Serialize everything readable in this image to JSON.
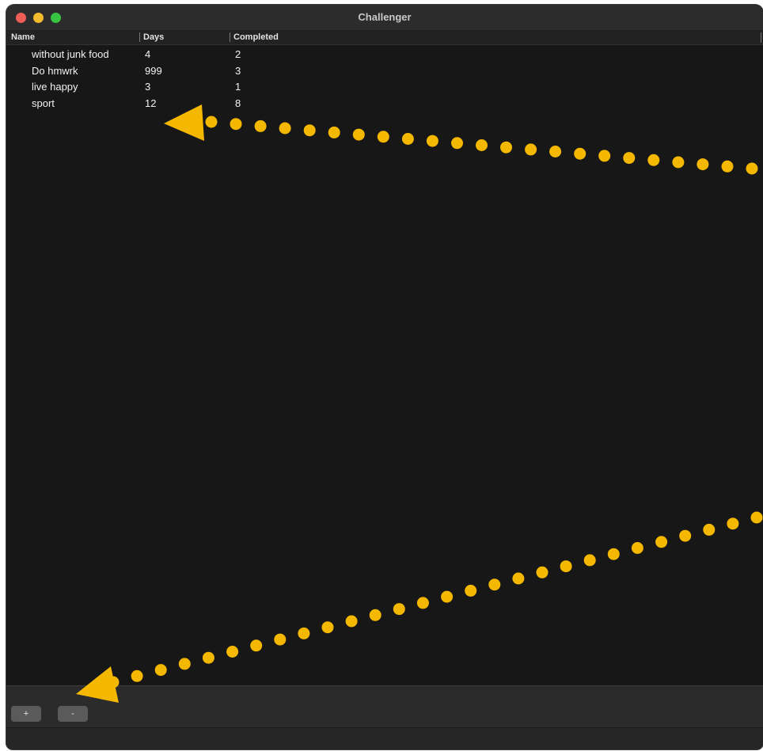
{
  "window": {
    "title": "Challenger"
  },
  "table": {
    "columns": [
      "Name",
      "Days",
      "Completed"
    ],
    "rows": [
      {
        "name": "without junk food",
        "days": "4",
        "completed": "2"
      },
      {
        "name": "Do hmwrk",
        "days": "999",
        "completed": "3"
      },
      {
        "name": "live happy",
        "days": "3",
        "completed": "1"
      },
      {
        "name": "sport",
        "days": "12",
        "completed": "8"
      }
    ]
  },
  "toolbar": {
    "add_label": "+",
    "remove_label": "-"
  },
  "colors": {
    "window_background": "#171717",
    "annotation": "#f5b800",
    "close": "#ee5d56",
    "minimize": "#f4bb2f",
    "zoom": "#37c541"
  }
}
